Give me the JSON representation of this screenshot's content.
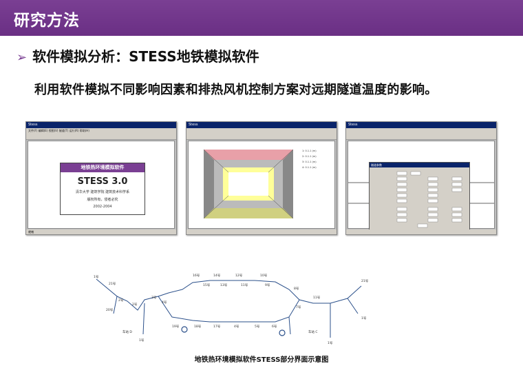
{
  "header": {
    "title": "研究方法"
  },
  "subtitle": {
    "arrow": "➢",
    "text": "软件模拟分析：STESS地铁模拟软件"
  },
  "description": "利用软件模拟不同影响因素和排热风机控制方案对远期隧道温度的影响。",
  "screenshot1": {
    "window_title": "Stess",
    "menu": "文件(F)  编辑(E)  视图(V)  隧道(T)  运行(R)  帮助(H)",
    "splash_header": "地铁热环境模拟软件",
    "splash_name": "STESS 3.0",
    "splash_org": "清华大学 建筑学院  建筑技术科学系",
    "splash_author": "版权所有，侵者必究",
    "splash_year": "2002-2004",
    "status": "就绪"
  },
  "screenshot2": {
    "window_title": "Stess",
    "legend": [
      "1: 0.1.1 (m)",
      "2: 0.1.1 (m)",
      "3: 0.1.1 (m)",
      "4: 0.1.1 (m)"
    ]
  },
  "screenshot3": {
    "window_title": "Stess",
    "dialog_title": "隧道参数",
    "ok": "确定",
    "cancel": "取消"
  },
  "network": {
    "caption": "地铁热环境模拟软件STESS部分界面示意图",
    "labels": [
      "1号",
      "21号",
      "2号",
      "20号",
      "2号",
      "3号",
      "4号",
      "16号",
      "15号",
      "14号",
      "13号",
      "12号",
      "11号",
      "10号",
      "9号",
      "8号",
      "7号",
      "6号",
      "5号",
      "4号",
      "17号",
      "18号",
      "19号",
      "11号",
      "21号",
      "1号",
      "车站 D",
      "车站 C",
      "1号",
      "1号"
    ]
  },
  "colors": {
    "accent": "#7a3f93"
  }
}
